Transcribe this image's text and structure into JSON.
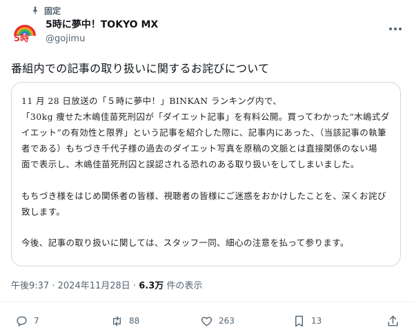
{
  "pinned": {
    "label": "固定"
  },
  "author": {
    "display_name": "5時に夢中！TOKYO MX",
    "handle": "@gojimu",
    "avatar_text": "5時"
  },
  "tweet": {
    "text": "番組内での記事の取り扱いに関するお詫びについて"
  },
  "statement_card": {
    "lines": [
      "11 月 28 日放送の「５時に夢中！」BINKAN ランキング内で、",
      "「30kg 痩せた木嶋佳苗死刑囚が「ダイエット記事」を有料公開。買ってわかった“木嶋式ダ",
      "イエット”の有効性と限界」という記事を紹介した際に、記事内にあった、（当該記事の執筆",
      "者である）もちづき千代子様の過去のダイエット写真を原稿の文脈とは直接関係のない場",
      "面で表示し、木嶋佳苗死刑囚と誤認される恐れのある取り扱いをしてしまいました。",
      "もちづき様をはじめ関係者の皆様、視聴者の皆様にご迷惑をおかけしたことを、深くお詫び",
      "致します。",
      "今後、記事の取り扱いに関しては、スタッフ一同、細心の注意を払って参ります。"
    ]
  },
  "meta": {
    "time": "午後9:37",
    "sep": "·",
    "date": "2024年11月28日",
    "views": "6.3万",
    "views_suffix": "件の表示"
  },
  "actions": {
    "replies": "7",
    "reposts": "88",
    "likes": "263",
    "bookmarks": "13"
  },
  "colors": {
    "text": "#0f1419",
    "secondary": "#536471",
    "border": "#cfd9de"
  }
}
